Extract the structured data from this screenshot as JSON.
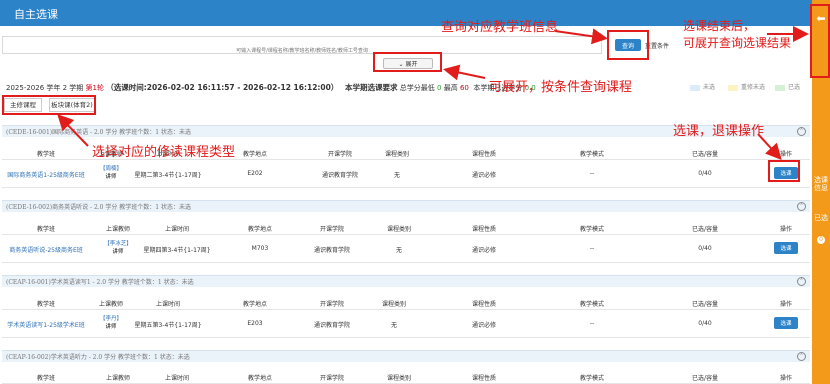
{
  "header": {
    "title": "自主选课"
  },
  "search": {
    "placeholder": "可输入课程号/课程名称/教学班名称/教师姓名/教师工号查询",
    "query_label": "查询",
    "reset_label": "重置条件",
    "expand_label": "展开"
  },
  "info": {
    "term": "2025-2026 学年 2 学期",
    "round": "第1轮",
    "time_label": "（选课时间:",
    "time_value": "2026-02-02 16:11:57 - 2026-02-12 16:12:00）",
    "req_label": "本学期选课要求",
    "min_label": "总学分最低",
    "min_value": "0",
    "max_label": "最高",
    "max_value": "60",
    "selected_label": "本学期已选学分",
    "selected_value": "0.0"
  },
  "legend": {
    "unselected": "未选",
    "conflict": "重修未选",
    "selected": "已选"
  },
  "tabs": [
    {
      "label": "主修课程"
    },
    {
      "label": "板块课(体育2)"
    }
  ],
  "columns": {
    "class": "教学班",
    "teacher": "上课教师",
    "time": "上课时间",
    "place": "教学地点",
    "college": "开课学院",
    "category": "课程类别",
    "nature": "课程性质",
    "mode": "教学模式",
    "capacity": "已选/容量",
    "op": "操作"
  },
  "sections": [
    {
      "title": "(CEDE-16-001)国际商务英语 - 2.0 学分     教学班个数：1     状态：未选",
      "row": {
        "class": "国际商务英语1-25级商务E班",
        "teacher_tag": "【周楠】",
        "teacher_role": "讲师",
        "time": "星期二第3-4节{1-17周}",
        "place": "E202",
        "college": "通识教育学院",
        "category": "无",
        "nature": "通识必修",
        "mode": "--",
        "capacity": "0/40",
        "op": "选课"
      }
    },
    {
      "title": "(CEDE-16-002)商务英语听说 - 2.0 学分     教学班个数：1     状态：未选",
      "row": {
        "class": "商务英语听说-25级商务E班",
        "teacher_tag": "【李冰芝】",
        "teacher_role": "讲师",
        "time": "星期四第3-4节{1-17周}",
        "place": "M703",
        "college": "通识教育学院",
        "category": "无",
        "nature": "通识必修",
        "mode": "--",
        "capacity": "0/40",
        "op": "选课"
      }
    },
    {
      "title": "(CEAP-16-001)学术英语读写1 - 2.0 学分     教学班个数：1     状态：未选",
      "row": {
        "class": "学术英语读写1-25级学术E班",
        "teacher_tag": "【李丹】",
        "teacher_role": "讲师",
        "time": "星期五第3-4节{1-17周}",
        "place": "E203",
        "college": "通识教育学院",
        "category": "无",
        "nature": "通识必修",
        "mode": "--",
        "capacity": "0/40",
        "op": "选课"
      }
    },
    {
      "title": "(CEAP-16-002)学术英语听力 - 2.0 学分     教学班个数：1     状态：未选"
    }
  ],
  "annotations": {
    "query": "查询对应教学班信息",
    "result": "选课结束后，\n可展开查询选课结果",
    "expand": "可展开，按条件查询课程",
    "select": "选课，退课操作",
    "type": "选择对应的修读课程类型"
  },
  "side": {
    "text1": "选课信息",
    "text2": "已选",
    "dot": "0"
  },
  "colors": {
    "header": "#2c83c7",
    "side": "#f39a1b",
    "annotation": "#e21b1b"
  }
}
